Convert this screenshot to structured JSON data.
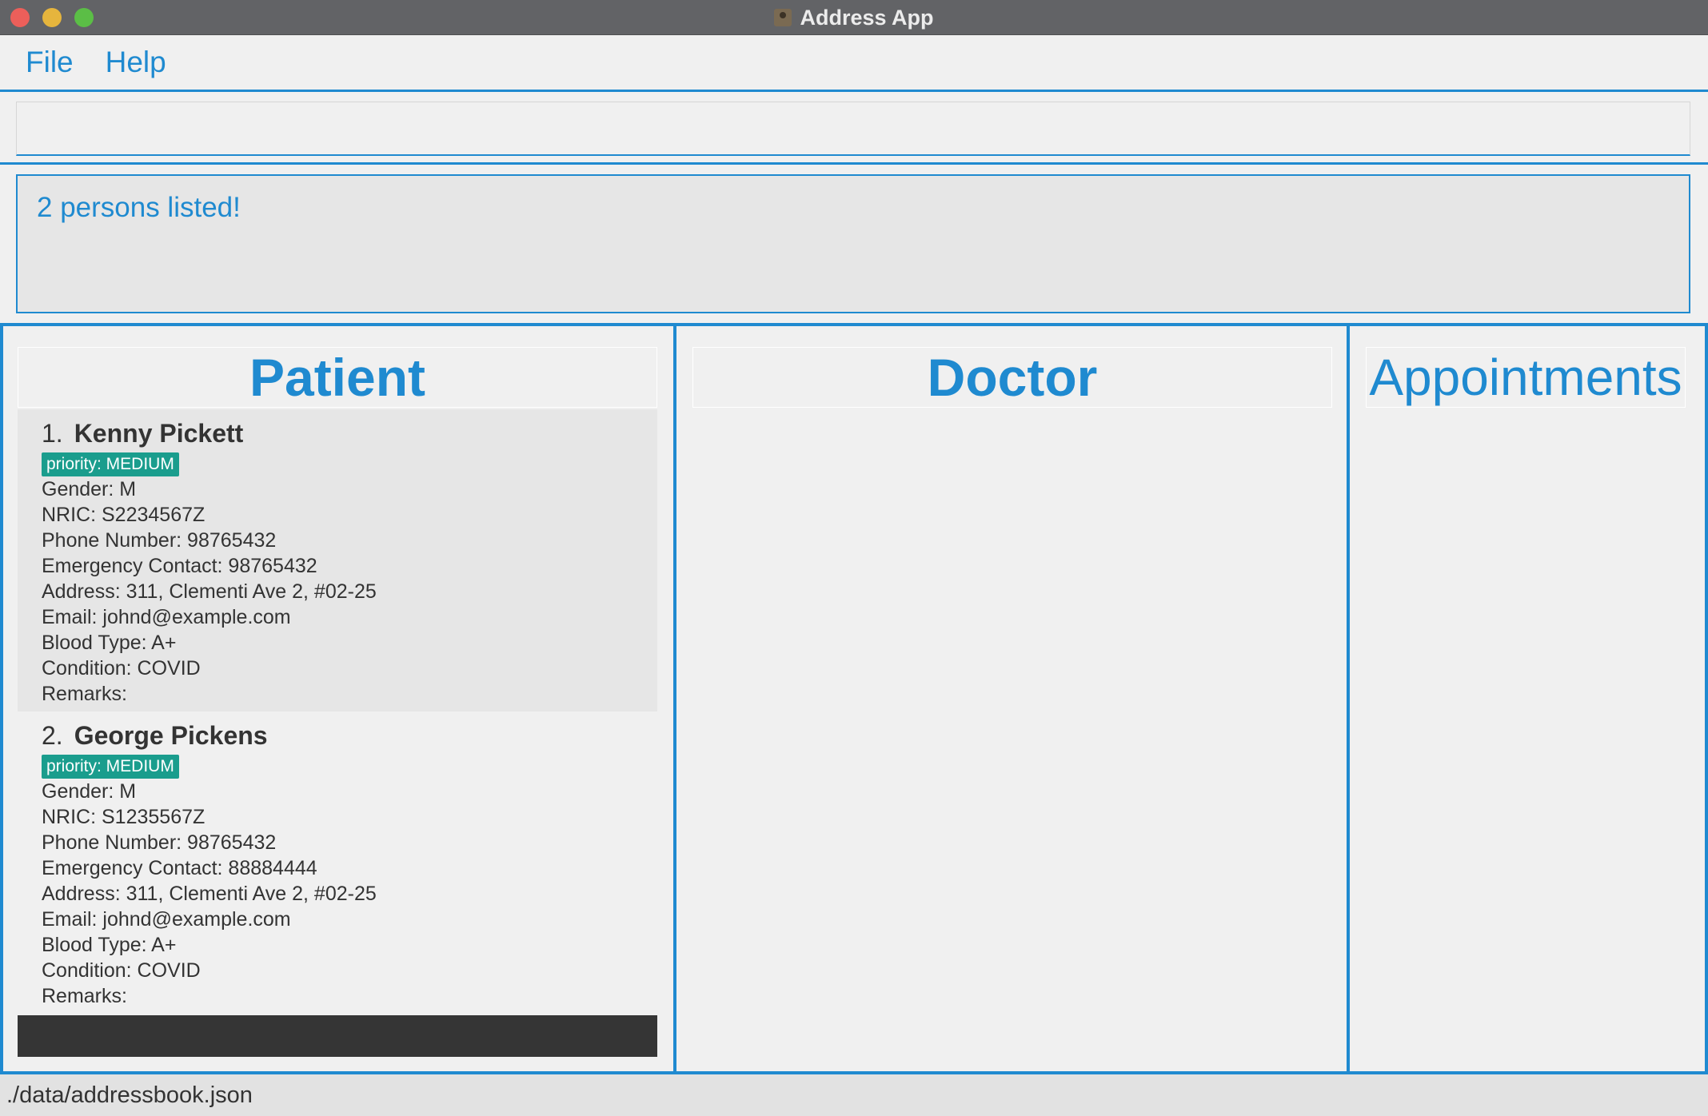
{
  "window": {
    "title": "Address App"
  },
  "menu": {
    "items": [
      "File",
      "Help"
    ]
  },
  "command": {
    "value": "",
    "placeholder": ""
  },
  "result": {
    "message": "2 persons listed!"
  },
  "columns": {
    "patient": "Patient",
    "doctor": "Doctor",
    "appointments": "Appointments"
  },
  "patients": [
    {
      "index": "1.",
      "name": "Kenny Pickett",
      "tag": "priority: MEDIUM",
      "gender": "Gender: M",
      "nric": "NRIC: S2234567Z",
      "phone": "Phone Number: 98765432",
      "emergency": "Emergency Contact: 98765432",
      "address": "Address: 311, Clementi Ave 2, #02-25",
      "email": "Email: johnd@example.com",
      "blood": "Blood Type: A+",
      "condition": "Condition: COVID",
      "remarks": "Remarks:"
    },
    {
      "index": "2.",
      "name": "George Pickens",
      "tag": "priority: MEDIUM",
      "gender": "Gender: M",
      "nric": "NRIC: S1235567Z",
      "phone": "Phone Number: 98765432",
      "emergency": "Emergency Contact: 88884444",
      "address": "Address: 311, Clementi Ave 2, #02-25",
      "email": "Email: johnd@example.com",
      "blood": "Blood Type: A+",
      "condition": "Condition: COVID",
      "remarks": "Remarks:"
    }
  ],
  "status": {
    "path": "./data/addressbook.json"
  },
  "colors": {
    "accent": "#1f8ad0",
    "tag": "#1a9d8d",
    "titlebar": "#626366"
  }
}
